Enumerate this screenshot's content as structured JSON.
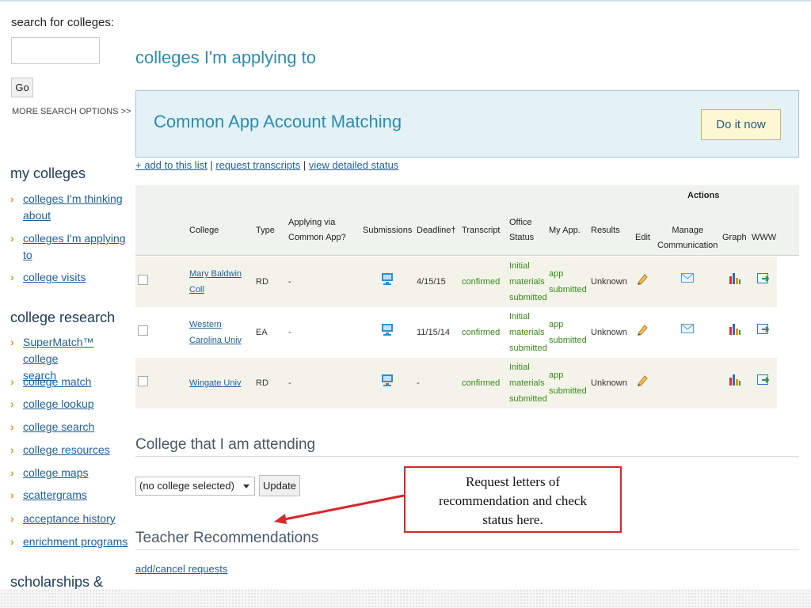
{
  "sidebar": {
    "search_label": "search for colleges:",
    "go_label": "Go",
    "more_search": "MORE SEARCH OPTIONS >>",
    "my_colleges_head": "my colleges",
    "my_colleges": [
      {
        "label": "colleges I'm thinking about"
      },
      {
        "label": "colleges I'm applying to"
      },
      {
        "label": "college visits"
      }
    ],
    "research_head": "college research",
    "research": [
      {
        "label": "SuperMatch™ college search"
      },
      {
        "label": "college match"
      },
      {
        "label": "college lookup"
      },
      {
        "label": "college search"
      },
      {
        "label": "college resources"
      },
      {
        "label": "college maps"
      },
      {
        "label": "scattergrams"
      },
      {
        "label": "acceptance history"
      },
      {
        "label": "enrichment programs"
      }
    ],
    "scholarships_head": "scholarships &"
  },
  "main": {
    "title": "colleges I'm applying to",
    "banner_text": "Common App Account Matching",
    "banner_button": "Do it now",
    "links": {
      "add": "+ add to this list",
      "sep1": " | ",
      "request": "request transcripts",
      "sep2": " | ",
      "status": "view detailed status"
    },
    "table": {
      "actions_header": "Actions",
      "headers": {
        "college": "College",
        "type": "Type",
        "common_app_1": "Applying via",
        "common_app_2": "Common App?",
        "submissions": "Submissions",
        "deadline": "Deadline†",
        "transcript": "Transcript",
        "office_1": "Office",
        "office_2": "Status",
        "myapp": "My App.",
        "results": "Results",
        "edit": "Edit",
        "manage_1": "Manage",
        "manage_2": "Communication",
        "graph": "Graph",
        "www": "WWW"
      },
      "rows": [
        {
          "college_1": "Mary Baldwin",
          "college_2": "Coll",
          "type": "RD",
          "common_app": "-",
          "deadline": "4/15/15",
          "transcript": "confirmed",
          "office_1": "Initial",
          "office_2": "materials",
          "office_3": "submitted",
          "myapp_1": "app",
          "myapp_2": "submitted",
          "results": "Unknown",
          "has_mail": true
        },
        {
          "college_1": "Western",
          "college_2": "Carolina Univ",
          "type": "EA",
          "common_app": "-",
          "deadline": "11/15/14",
          "transcript": "confirmed",
          "office_1": "Initial",
          "office_2": "materials",
          "office_3": "submitted",
          "myapp_1": "app",
          "myapp_2": "submitted",
          "results": "Unknown",
          "has_mail": true
        },
        {
          "college_1": "Wingate Univ",
          "college_2": "",
          "type": "RD",
          "common_app": "-",
          "deadline": "-",
          "transcript": "confirmed",
          "office_1": "Initial",
          "office_2": "materials",
          "office_3": "submitted",
          "myapp_1": "app",
          "myapp_2": "submitted",
          "results": "Unknown",
          "has_mail": false
        }
      ]
    },
    "attending_head": "College that I am attending",
    "select_value": "(no college selected)",
    "update_label": "Update",
    "recommendations_head": "Teacher Recommendations",
    "add_cancel": "add/cancel requests"
  },
  "callout": {
    "line1": "Request letters of",
    "line2": "recommendation and check",
    "line3": "status here."
  },
  "colors": {
    "accent": "#2a8db0",
    "link": "#1f5f99",
    "chevron": "#e8961c",
    "callout_border": "#d9252b",
    "status_green": "#3a8a1a"
  }
}
